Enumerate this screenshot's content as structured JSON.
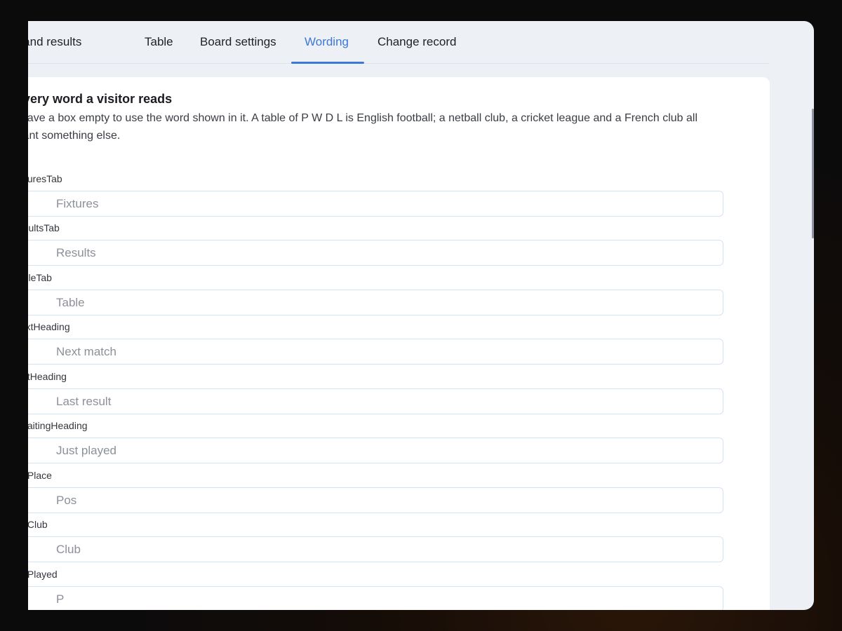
{
  "tabs": [
    {
      "label": "Fixtures and results"
    },
    {
      "label": "Table"
    },
    {
      "label": "Board settings"
    },
    {
      "label": "Wording",
      "active": true
    },
    {
      "label": "Change record"
    }
  ],
  "section": {
    "title": "Every word a visitor reads",
    "description": "Leave a box empty to use the word shown in it. A table of P W D L is English football; a netball club, a cricket league and a French club all want something else."
  },
  "fields": [
    {
      "label": "fixturesTab",
      "placeholder": "Fixtures",
      "value": ""
    },
    {
      "label": "resultsTab",
      "placeholder": "Results",
      "value": ""
    },
    {
      "label": "tableTab",
      "placeholder": "Table",
      "value": ""
    },
    {
      "label": "nextHeading",
      "placeholder": "Next match",
      "value": ""
    },
    {
      "label": "lastHeading",
      "placeholder": "Last result",
      "value": ""
    },
    {
      "label": "awaitingHeading",
      "placeholder": "Just played",
      "value": ""
    },
    {
      "label": "colPlace",
      "placeholder": "Pos",
      "value": ""
    },
    {
      "label": "colClub",
      "placeholder": "Club",
      "value": ""
    },
    {
      "label": "colPlayed",
      "placeholder": "P",
      "value": ""
    }
  ]
}
